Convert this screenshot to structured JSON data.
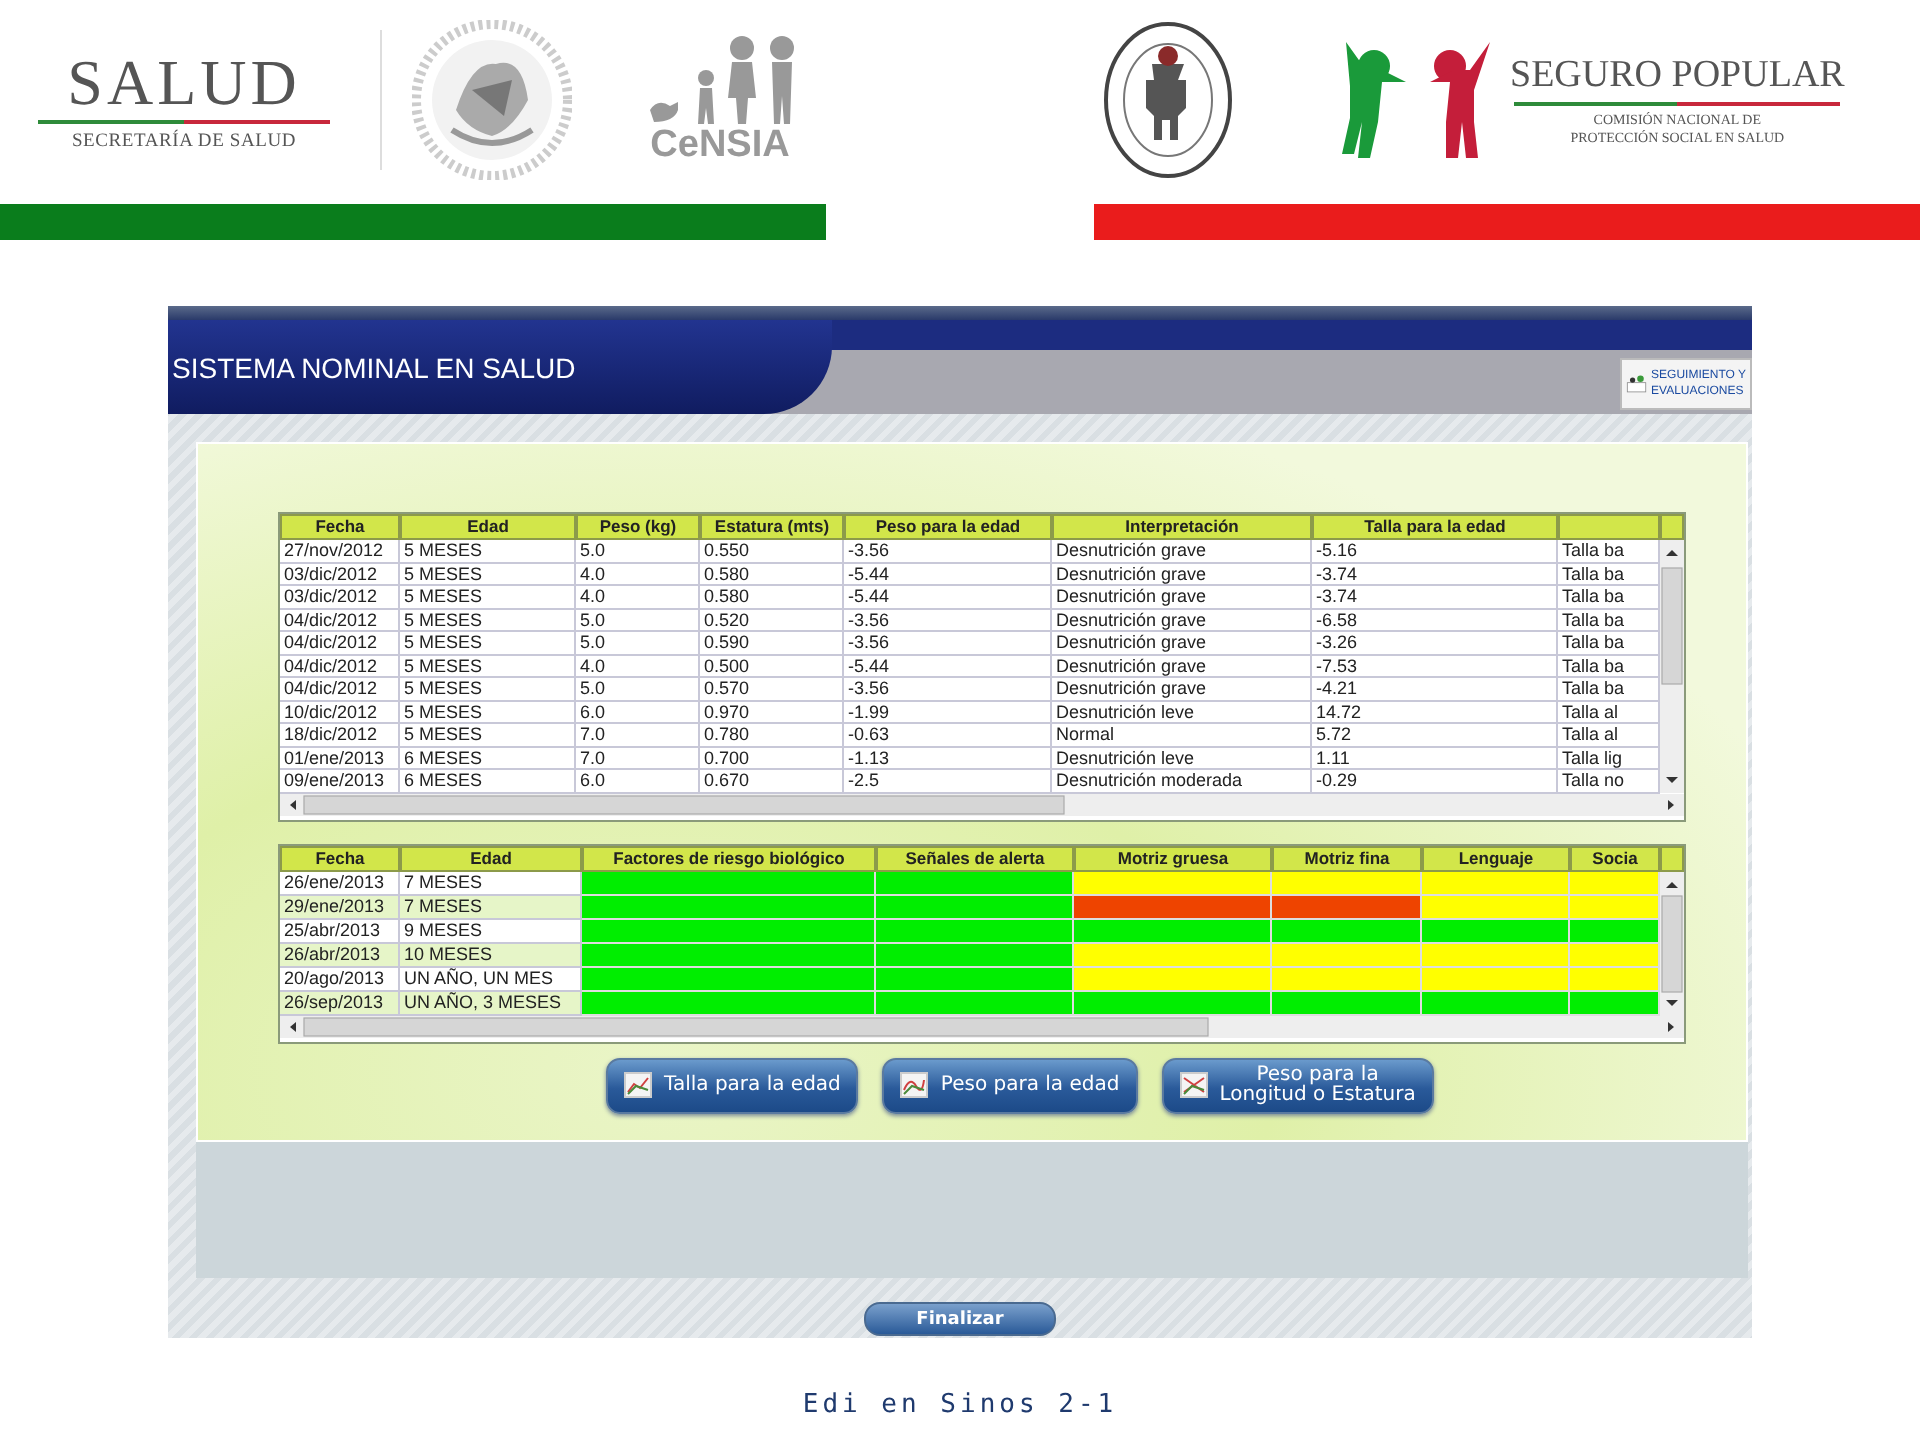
{
  "header": {
    "salud_logo": {
      "title": "SALUD",
      "subtitle": "SECRETARÍA DE SALUD"
    },
    "censia_logo": {
      "title": "CeNSIA"
    },
    "seguro_popular_logo": {
      "title": "SEGURO POPULAR",
      "subtitle_lines": [
        "COMISIÓN NACIONAL DE",
        "PROTECCIÓN SOCIAL EN SALUD"
      ]
    }
  },
  "app": {
    "banner_title": "SISTEMA NOMINAL EN SALUD",
    "nav_button": {
      "lines": [
        "SEGUIMIENTO Y",
        "EVALUACIONES"
      ]
    },
    "measurements": {
      "columns": [
        "Fecha",
        "Edad",
        "Peso (kg)",
        "Estatura (mts)",
        "Peso para la edad",
        "Interpretación",
        "Talla para la edad",
        ""
      ],
      "rows": [
        [
          "27/nov/2012",
          "5 MESES",
          "5.0",
          "0.550",
          "-3.56",
          "Desnutrición grave",
          "-5.16",
          "Talla ba"
        ],
        [
          "03/dic/2012",
          "5 MESES",
          "4.0",
          "0.580",
          "-5.44",
          "Desnutrición grave",
          "-3.74",
          "Talla ba"
        ],
        [
          "03/dic/2012",
          "5 MESES",
          "4.0",
          "0.580",
          "-5.44",
          "Desnutrición grave",
          "-3.74",
          "Talla ba"
        ],
        [
          "04/dic/2012",
          "5 MESES",
          "5.0",
          "0.520",
          "-3.56",
          "Desnutrición grave",
          "-6.58",
          "Talla ba"
        ],
        [
          "04/dic/2012",
          "5 MESES",
          "5.0",
          "0.590",
          "-3.56",
          "Desnutrición grave",
          "-3.26",
          "Talla ba"
        ],
        [
          "04/dic/2012",
          "5 MESES",
          "4.0",
          "0.500",
          "-5.44",
          "Desnutrición grave",
          "-7.53",
          "Talla ba"
        ],
        [
          "04/dic/2012",
          "5 MESES",
          "5.0",
          "0.570",
          "-3.56",
          "Desnutrición grave",
          "-4.21",
          "Talla ba"
        ],
        [
          "10/dic/2012",
          "5 MESES",
          "6.0",
          "0.970",
          "-1.99",
          "Desnutrición leve",
          "14.72",
          "Talla al"
        ],
        [
          "18/dic/2012",
          "5 MESES",
          "7.0",
          "0.780",
          "-0.63",
          "Normal",
          "5.72",
          "Talla al"
        ],
        [
          "01/ene/2013",
          "6 MESES",
          "7.0",
          "0.700",
          "-1.13",
          "Desnutrición leve",
          "1.11",
          "Talla lig"
        ],
        [
          "09/ene/2013",
          "6 MESES",
          "6.0",
          "0.670",
          "-2.5",
          "Desnutrición moderada",
          "-0.29",
          "Talla no"
        ]
      ]
    },
    "assessments": {
      "columns": [
        "Fecha",
        "Edad",
        "Factores de riesgo biológico",
        "Señales de alerta",
        "Motriz gruesa",
        "Motriz fina",
        "Lenguaje",
        "Socia"
      ],
      "rows": [
        {
          "date": "26/ene/2013",
          "age": "7 MESES",
          "cells": [
            {
              "color": "#00ee00"
            },
            {
              "color": "#00ee00"
            },
            {
              "color": "#ffff00"
            },
            {
              "color": "#ffff00"
            },
            {
              "color": "#ffff00"
            },
            {
              "color": "#ffff00"
            }
          ]
        },
        {
          "date": "29/ene/2013",
          "age": "7 MESES",
          "cells": [
            {
              "color": "#00ee00"
            },
            {
              "color": "#00ee00"
            },
            {
              "color": "#ee4400"
            },
            {
              "color": "#ee4400"
            },
            {
              "color": "#ffff00"
            },
            {
              "color": "#ffff00"
            }
          ]
        },
        {
          "date": "25/abr/2013",
          "age": "9 MESES",
          "cells": [
            {
              "color": "#00ee00"
            },
            {
              "color": "#00ee00"
            },
            {
              "color": "#00ee00"
            },
            {
              "color": "#00ee00"
            },
            {
              "color": "#00ee00"
            },
            {
              "color": "#00ee00"
            }
          ]
        },
        {
          "date": "26/abr/2013",
          "age": "10 MESES",
          "cells": [
            {
              "color": "#00ee00"
            },
            {
              "color": "#00ee00"
            },
            {
              "color": "#ffff00"
            },
            {
              "color": "#ffff00"
            },
            {
              "color": "#ffff00"
            },
            {
              "color": "#ffff00"
            }
          ]
        },
        {
          "date": "20/ago/2013",
          "age": "UN AÑO,  UN MES",
          "cells": [
            {
              "color": "#00ee00"
            },
            {
              "color": "#00ee00"
            },
            {
              "color": "#ffff00"
            },
            {
              "color": "#ffff00"
            },
            {
              "color": "#ffff00"
            },
            {
              "color": "#ffff00"
            }
          ]
        },
        {
          "date": "26/sep/2013",
          "age": " UN AÑO, 3 MESES",
          "cells": [
            {
              "color": "#00ee00"
            },
            {
              "color": "#00ee00"
            },
            {
              "color": "#00ee00"
            },
            {
              "color": "#00ee00"
            },
            {
              "color": "#00ee00"
            },
            {
              "color": "#00ee00"
            }
          ]
        }
      ]
    },
    "chart_buttons": [
      {
        "lines": [
          "Talla para la edad"
        ]
      },
      {
        "lines": [
          "Peso para la edad"
        ]
      },
      {
        "lines": [
          "Peso para la",
          "Longitud o Estatura"
        ]
      }
    ],
    "finish_button": "Finalizar"
  },
  "footer": "Edi en Sinos 2-1"
}
